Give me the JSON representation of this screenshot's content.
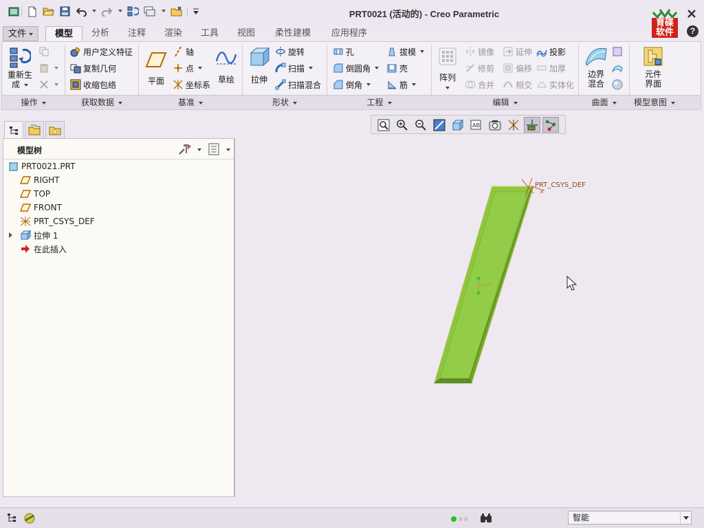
{
  "window": {
    "title": "PRT0021 (活动的) - Creo Parametric",
    "logo_text": [
      "育碟",
      "软件"
    ]
  },
  "quick_access": [
    "window-icon",
    "new-icon",
    "open-icon",
    "save-icon",
    "undo-icon",
    "redo-icon",
    "regenerate-icon",
    "windows-icon",
    "close-window-icon",
    "customize-icon"
  ],
  "tabs": [
    {
      "label": "文件",
      "kind": "file"
    },
    {
      "label": "模型",
      "kind": "active"
    },
    {
      "label": "分析"
    },
    {
      "label": "注释"
    },
    {
      "label": "渲染"
    },
    {
      "label": "工具"
    },
    {
      "label": "视图"
    },
    {
      "label": "柔性建模"
    },
    {
      "label": "应用程序"
    }
  ],
  "ribbon": {
    "groups": [
      "操作",
      "获取数据",
      "基准",
      "形状",
      "工程",
      "编辑",
      "曲面",
      "模型意图"
    ],
    "operations": {
      "regenerate_l1": "重新生",
      "regenerate_l2": "成"
    },
    "get_data": {
      "user_feature": "用户定义特征",
      "copy_geometry": "复制几何",
      "shrinkwrap": "收缩包络"
    },
    "datum": {
      "plane": "平面",
      "axis": "轴",
      "point": "点",
      "csys": "坐标系",
      "sketch": "草绘"
    },
    "shapes": {
      "extrude": "拉伸",
      "revolve": "旋转",
      "sweep": "扫描",
      "swept_blend": "扫描混合"
    },
    "engineering": {
      "hole": "孔",
      "round": "倒圆角",
      "chamfer": "倒角",
      "draft": "拔模",
      "shell": "壳",
      "rib": "筋"
    },
    "editing": {
      "pattern": "阵列",
      "mirror": "镜像",
      "trim": "修剪",
      "merge": "合并",
      "extend": "延伸",
      "offset": "偏移",
      "intersect": "相交",
      "project": "投影",
      "thicken": "加厚",
      "solidify": "实体化"
    },
    "surfaces": {
      "boundary_blend_l1": "边界",
      "boundary_blend_l2": "混合"
    },
    "model_intent": {
      "component_interface_l1": "元件",
      "component_interface_l2": "界面"
    }
  },
  "model_tree": {
    "title": "模型树",
    "items": [
      {
        "label": "PRT0021.PRT",
        "icon": "part-icon"
      },
      {
        "label": "RIGHT",
        "icon": "datum-plane-icon"
      },
      {
        "label": "TOP",
        "icon": "datum-plane-icon"
      },
      {
        "label": "FRONT",
        "icon": "datum-plane-icon"
      },
      {
        "label": "PRT_CSYS_DEF",
        "icon": "csys-icon"
      },
      {
        "label": "拉伸 1",
        "icon": "extrude-icon"
      },
      {
        "label": "在此插入",
        "icon": "insert-arrow-icon"
      }
    ]
  },
  "graphics_toolbar": [
    "refit-icon",
    "zoom-in-icon",
    "zoom-out-icon",
    "repaint-icon",
    "display-style-icon",
    "saved-views-icon",
    "view-manager-icon",
    "datum-display-icon",
    "spin-center-icon",
    "annotation-display-icon"
  ],
  "canvas": {
    "csys_label": "PRT_CSYS_DEF",
    "model_color": "#8dc63f"
  },
  "statusbar": {
    "filter": "智能"
  }
}
